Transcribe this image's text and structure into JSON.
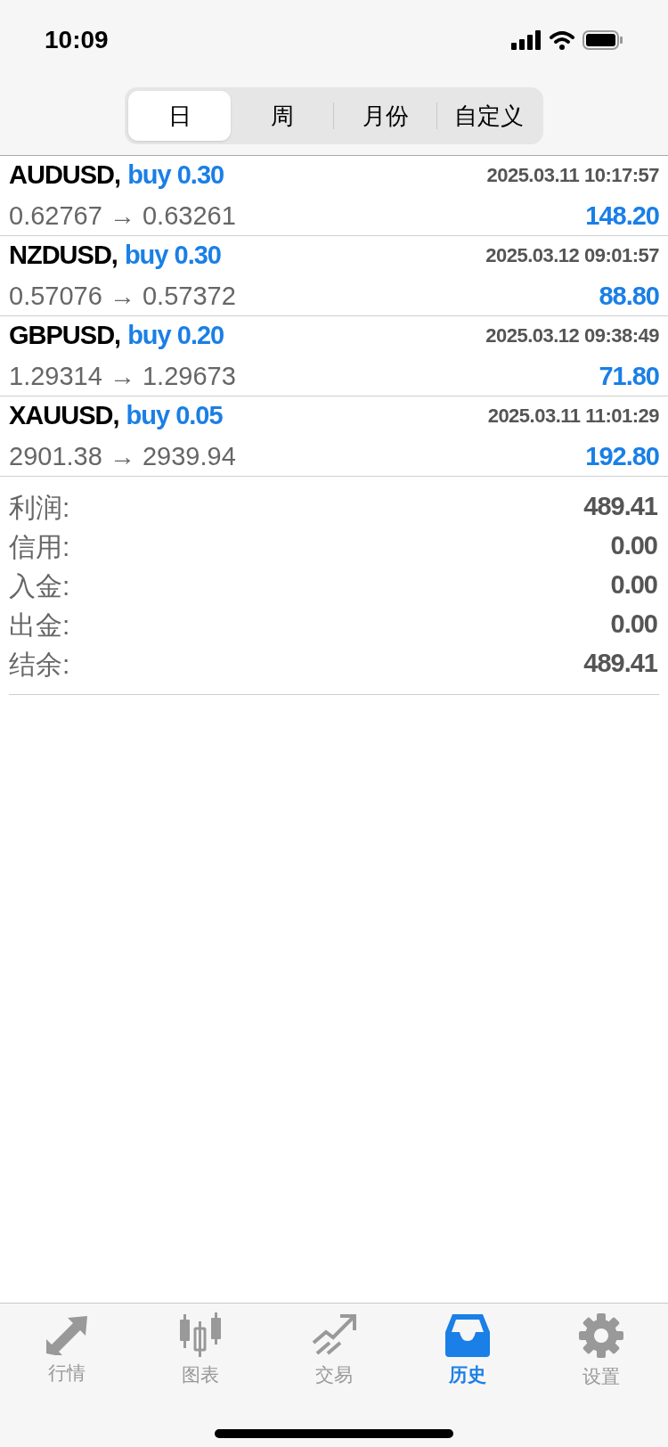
{
  "status_bar": {
    "time": "10:09"
  },
  "segments": [
    {
      "label": "日",
      "selected": true
    },
    {
      "label": "周",
      "selected": false
    },
    {
      "label": "月份",
      "selected": false
    },
    {
      "label": "自定义",
      "selected": false
    }
  ],
  "deals": [
    {
      "symbol": "AUDUSD,",
      "side": "buy 0.30",
      "time": "2025.03.11 10:17:57",
      "prices": "0.62767 → 0.63261",
      "profit": "148.20"
    },
    {
      "symbol": "NZDUSD,",
      "side": "buy 0.30",
      "time": "2025.03.12 09:01:57",
      "prices": "0.57076 → 0.57372",
      "profit": "88.80"
    },
    {
      "symbol": "GBPUSD,",
      "side": "buy 0.20",
      "time": "2025.03.12 09:38:49",
      "prices": "1.29314 → 1.29673",
      "profit": "71.80"
    },
    {
      "symbol": "XAUUSD,",
      "side": "buy 0.05",
      "time": "2025.03.11 11:01:29",
      "prices": "2901.38 → 2939.94",
      "profit": "192.80"
    }
  ],
  "summary": [
    {
      "label": "利润:",
      "value": "489.41"
    },
    {
      "label": "信用:",
      "value": "0.00"
    },
    {
      "label": "入金:",
      "value": "0.00"
    },
    {
      "label": "出金:",
      "value": "0.00"
    },
    {
      "label": "结余:",
      "value": "489.41"
    }
  ],
  "tab_bar": [
    {
      "kind": "quotes",
      "label": "行情",
      "selected": false
    },
    {
      "kind": "chart",
      "label": "图表",
      "selected": false
    },
    {
      "kind": "trade",
      "label": "交易",
      "selected": false
    },
    {
      "kind": "history",
      "label": "历史",
      "selected": true
    },
    {
      "kind": "settings",
      "label": "设置",
      "selected": false
    }
  ]
}
